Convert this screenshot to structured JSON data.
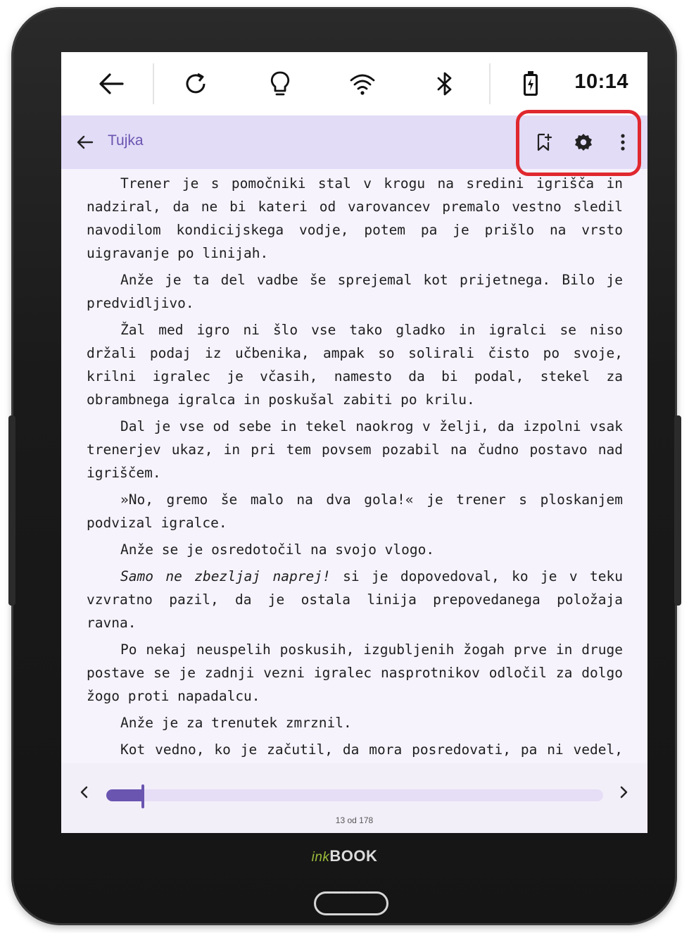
{
  "status_bar": {
    "icons": [
      "back-arrow-icon",
      "refresh-icon",
      "lightbulb-icon",
      "wifi-icon",
      "bluetooth-icon",
      "battery-icon"
    ],
    "time": "10:14"
  },
  "app_bar": {
    "title": "Tujka",
    "tools": [
      "bookmark-add-icon",
      "settings-gear-icon",
      "more-vert-icon"
    ],
    "highlight_color": "#e0282f",
    "background": "#e2dcf7",
    "accent": "#6a55b0"
  },
  "reading": {
    "paragraphs": [
      "Trener je s pomočniki stal v krogu na sredini igrišča in nadziral, da ne bi kateri od varovancev premalo vestno sledil navodilom kondicijskega vodje, potem pa je prišlo na vrsto uigravanje po linijah.",
      "Anže je ta del vadbe še sprejemal kot prijetnega. Bilo je predvidljivo.",
      "Žal med igro ni šlo vse tako gladko in igralci se niso držali podaj iz učbenika, ampak so solirali čisto po svoje, krilni igralec je včasih, namesto da bi podal, stekel za obrambnega igralca in poskušal zabiti po krilu.",
      "Dal je vse od sebe in tekel naokrog v želji, da izpolni vsak trenerjev ukaz, in pri tem povsem pozabil na čudno postavo nad igriščem.",
      "»No, gremo še malo na dva gola!« je trener s ploskanjem podvizal igralce.",
      "Anže se je osredotočil na svojo vlogo.",
      "Po nekaj neuspelih poskusih, izgubljenih žogah prve in druge postave se je zadnji vezni igralec nasprotnikov odločil za dolgo žogo proti napadalcu.",
      "Anže je za trenutek zmrznil.",
      "Kot vedno, ko je začutil, da mora posredovati, pa ni vedel, kako in ali mu bo uspelo. Istočasno z razmislekom, kakšen nasvet mu je dal trener za tak primer, je na hrbtu začutil vrtajoče"
    ],
    "italic_paragraph": {
      "italic": "Samo ne zbezljaj naprej!",
      "rest": " si je dopovedoval, ko je v teku vzvratno pazil, da je ostala linija prepovedanega položaja ravna."
    }
  },
  "navigation": {
    "prev_icon": "chevron-left-icon",
    "next_icon": "chevron-right-icon",
    "page_label": "13 od 178",
    "progress": 0.073
  },
  "device": {
    "brand_ink": "ink",
    "brand_book": "BOOK"
  }
}
